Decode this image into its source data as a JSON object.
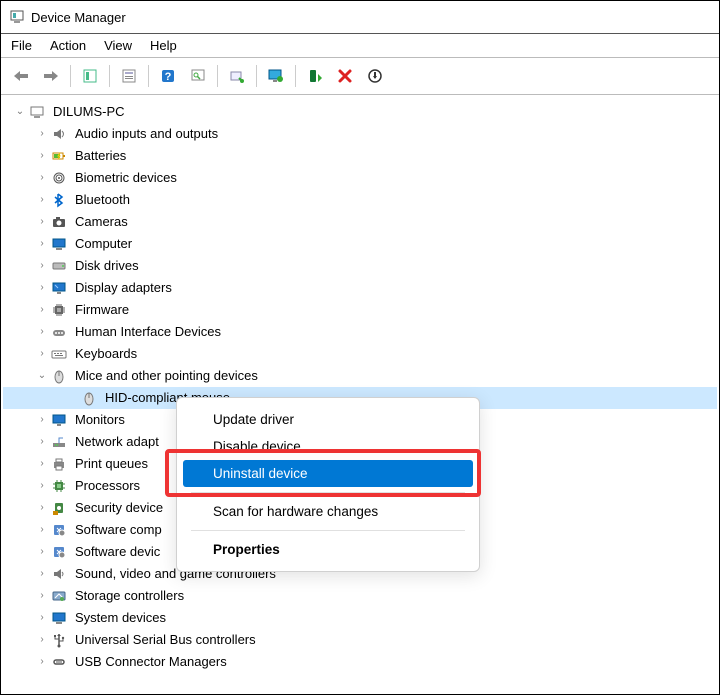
{
  "window": {
    "title": "Device Manager"
  },
  "menu": {
    "file": "File",
    "action": "Action",
    "view": "View",
    "help": "Help"
  },
  "tree": {
    "root": "DILUMS-PC",
    "items": [
      {
        "label": "Audio inputs and outputs",
        "icon": "speaker"
      },
      {
        "label": "Batteries",
        "icon": "battery"
      },
      {
        "label": "Biometric devices",
        "icon": "fingerprint"
      },
      {
        "label": "Bluetooth",
        "icon": "bluetooth"
      },
      {
        "label": "Cameras",
        "icon": "camera"
      },
      {
        "label": "Computer",
        "icon": "computer"
      },
      {
        "label": "Disk drives",
        "icon": "disk"
      },
      {
        "label": "Display adapters",
        "icon": "display"
      },
      {
        "label": "Firmware",
        "icon": "chip"
      },
      {
        "label": "Human Interface Devices",
        "icon": "hid"
      },
      {
        "label": "Keyboards",
        "icon": "keyboard"
      },
      {
        "label": "Mice and other pointing devices",
        "icon": "mouse",
        "expanded": true,
        "children": [
          {
            "label": "HID-compliant mouse",
            "icon": "mouse",
            "selected": true
          }
        ]
      },
      {
        "label": "Monitors",
        "icon": "monitor"
      },
      {
        "label": "Network adapt",
        "icon": "network"
      },
      {
        "label": "Print queues",
        "icon": "printer"
      },
      {
        "label": "Processors",
        "icon": "cpu"
      },
      {
        "label": "Security device",
        "icon": "security"
      },
      {
        "label": "Software comp",
        "icon": "software"
      },
      {
        "label": "Software devic",
        "icon": "software"
      },
      {
        "label": "Sound, video and game controllers",
        "icon": "sound"
      },
      {
        "label": "Storage controllers",
        "icon": "storage"
      },
      {
        "label": "System devices",
        "icon": "system"
      },
      {
        "label": "Universal Serial Bus controllers",
        "icon": "usb"
      },
      {
        "label": "USB Connector Managers",
        "icon": "usb-c"
      }
    ]
  },
  "context_menu": {
    "items": [
      {
        "label": "Update driver"
      },
      {
        "label": "Disable device"
      },
      {
        "label": "Uninstall device",
        "highlight": true
      },
      {
        "sep": true
      },
      {
        "label": "Scan for hardware changes"
      },
      {
        "sep": true
      },
      {
        "label": "Properties",
        "bold": true
      }
    ]
  }
}
